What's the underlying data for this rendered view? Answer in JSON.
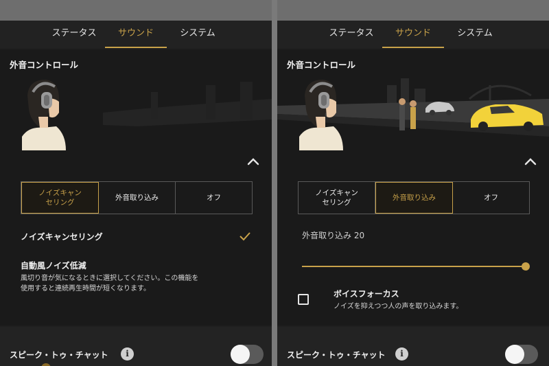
{
  "tabs": [
    "ステータス",
    "サウンド",
    "システム"
  ],
  "left": {
    "section_title": "外音コントロール",
    "segments": [
      "ノイズキャン\nセリング",
      "外音取り込み",
      "オフ"
    ],
    "active_segment": 0,
    "nc_row_label": "ノイズキャンセリング",
    "wind_title": "自動風ノイズ低減",
    "wind_desc": "風切り音が気になるときに選択してください。この機能を\n使用すると連続再生時間が短くなります。",
    "bottom_label": "スピーク・トゥ・チャット",
    "info_glyph": "i",
    "toggle_on": false
  },
  "right": {
    "section_title": "外音コントロール",
    "segments": [
      "ノイズキャン\nセリング",
      "外音取り込み",
      "オフ"
    ],
    "active_segment": 1,
    "ambient_label": "外音取り込み 20",
    "ambient_level": 20,
    "ambient_max": 20,
    "voice_focus_title": "ボイスフォーカス",
    "voice_focus_desc": "ノイズを抑えつつ人の声を取り込みます。",
    "voice_focus_checked": false,
    "bottom_label": "スピーク・トゥ・チャット",
    "info_glyph": "i",
    "toggle_on": false
  },
  "colors": {
    "accent": "#c9a24a",
    "background": "#1a1a1a",
    "car": "#f2d23a"
  },
  "icons": [
    "chevron-up-icon",
    "checkmark-icon",
    "info-icon",
    "headphone-user-illustration"
  ]
}
